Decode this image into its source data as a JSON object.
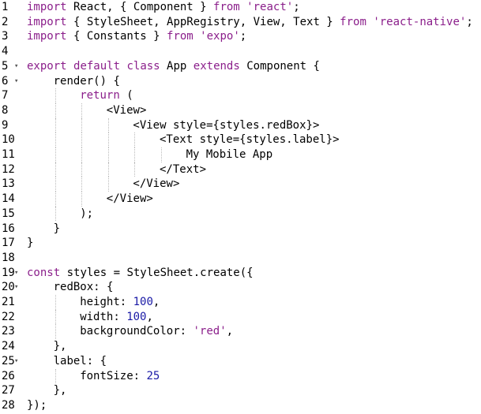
{
  "editor": {
    "lines": [
      {
        "n": "1",
        "fold": "",
        "indent": 0,
        "tokens": [
          {
            "t": "kw",
            "v": "import"
          },
          {
            "t": "plain",
            "v": " React, { Component } "
          },
          {
            "t": "kw",
            "v": "from"
          },
          {
            "t": "plain",
            "v": " "
          },
          {
            "t": "str",
            "v": "'react'"
          },
          {
            "t": "plain",
            "v": ";"
          }
        ]
      },
      {
        "n": "2",
        "fold": "",
        "indent": 0,
        "tokens": [
          {
            "t": "kw",
            "v": "import"
          },
          {
            "t": "plain",
            "v": " { StyleSheet, AppRegistry, View, Text } "
          },
          {
            "t": "kw",
            "v": "from"
          },
          {
            "t": "plain",
            "v": " "
          },
          {
            "t": "str",
            "v": "'react-native'"
          },
          {
            "t": "plain",
            "v": ";"
          }
        ]
      },
      {
        "n": "3",
        "fold": "",
        "indent": 0,
        "tokens": [
          {
            "t": "kw",
            "v": "import"
          },
          {
            "t": "plain",
            "v": " { Constants } "
          },
          {
            "t": "kw",
            "v": "from"
          },
          {
            "t": "plain",
            "v": " "
          },
          {
            "t": "str",
            "v": "'expo'"
          },
          {
            "t": "plain",
            "v": ";"
          }
        ]
      },
      {
        "n": "4",
        "fold": "",
        "indent": 0,
        "tokens": []
      },
      {
        "n": "5",
        "fold": "▾",
        "indent": 0,
        "tokens": [
          {
            "t": "kw",
            "v": "export"
          },
          {
            "t": "plain",
            "v": " "
          },
          {
            "t": "kw",
            "v": "default"
          },
          {
            "t": "plain",
            "v": " "
          },
          {
            "t": "kw",
            "v": "class"
          },
          {
            "t": "plain",
            "v": " App "
          },
          {
            "t": "kw",
            "v": "extends"
          },
          {
            "t": "plain",
            "v": " Component {"
          }
        ]
      },
      {
        "n": "6",
        "fold": "▾",
        "indent": 1,
        "tokens": [
          {
            "t": "plain",
            "v": "render() {"
          }
        ]
      },
      {
        "n": "7",
        "fold": "",
        "indent": 2,
        "tokens": [
          {
            "t": "kw",
            "v": "return"
          },
          {
            "t": "plain",
            "v": " ("
          }
        ]
      },
      {
        "n": "8",
        "fold": "",
        "indent": 3,
        "tokens": [
          {
            "t": "plain",
            "v": "<View>"
          }
        ]
      },
      {
        "n": "9",
        "fold": "",
        "indent": 4,
        "tokens": [
          {
            "t": "plain",
            "v": "<View style={styles.redBox}>"
          }
        ]
      },
      {
        "n": "10",
        "fold": "",
        "indent": 5,
        "tokens": [
          {
            "t": "plain",
            "v": "<Text style={styles.label}>"
          }
        ]
      },
      {
        "n": "11",
        "fold": "",
        "indent": 6,
        "tokens": [
          {
            "t": "plain",
            "v": "My Mobile App"
          }
        ]
      },
      {
        "n": "12",
        "fold": "",
        "indent": 5,
        "tokens": [
          {
            "t": "plain",
            "v": "</Text>"
          }
        ]
      },
      {
        "n": "13",
        "fold": "",
        "indent": 4,
        "tokens": [
          {
            "t": "plain",
            "v": "</View>"
          }
        ]
      },
      {
        "n": "14",
        "fold": "",
        "indent": 3,
        "tokens": [
          {
            "t": "plain",
            "v": "</View>"
          }
        ]
      },
      {
        "n": "15",
        "fold": "",
        "indent": 2,
        "tokens": [
          {
            "t": "plain",
            "v": ");"
          }
        ]
      },
      {
        "n": "16",
        "fold": "",
        "indent": 1,
        "tokens": [
          {
            "t": "plain",
            "v": "}"
          }
        ]
      },
      {
        "n": "17",
        "fold": "",
        "indent": 0,
        "tokens": [
          {
            "t": "plain",
            "v": "}"
          }
        ]
      },
      {
        "n": "18",
        "fold": "",
        "indent": 0,
        "tokens": []
      },
      {
        "n": "19",
        "fold": "▾",
        "indent": 0,
        "tokens": [
          {
            "t": "kw",
            "v": "const"
          },
          {
            "t": "plain",
            "v": " styles = StyleSheet.create({"
          }
        ]
      },
      {
        "n": "20",
        "fold": "▾",
        "indent": 1,
        "tokens": [
          {
            "t": "plain",
            "v": "redBox: {"
          }
        ]
      },
      {
        "n": "21",
        "fold": "",
        "indent": 2,
        "tokens": [
          {
            "t": "plain",
            "v": "height: "
          },
          {
            "t": "num",
            "v": "100"
          },
          {
            "t": "plain",
            "v": ","
          }
        ]
      },
      {
        "n": "22",
        "fold": "",
        "indent": 2,
        "tokens": [
          {
            "t": "plain",
            "v": "width: "
          },
          {
            "t": "num",
            "v": "100"
          },
          {
            "t": "plain",
            "v": ","
          }
        ]
      },
      {
        "n": "23",
        "fold": "",
        "indent": 2,
        "tokens": [
          {
            "t": "plain",
            "v": "backgroundColor: "
          },
          {
            "t": "str",
            "v": "'red'"
          },
          {
            "t": "plain",
            "v": ","
          }
        ]
      },
      {
        "n": "24",
        "fold": "",
        "indent": 1,
        "tokens": [
          {
            "t": "plain",
            "v": "},"
          }
        ]
      },
      {
        "n": "25",
        "fold": "▾",
        "indent": 1,
        "tokens": [
          {
            "t": "plain",
            "v": "label: {"
          }
        ]
      },
      {
        "n": "26",
        "fold": "",
        "indent": 2,
        "tokens": [
          {
            "t": "plain",
            "v": "fontSize: "
          },
          {
            "t": "num",
            "v": "25"
          }
        ]
      },
      {
        "n": "27",
        "fold": "",
        "indent": 1,
        "tokens": [
          {
            "t": "plain",
            "v": "},"
          }
        ]
      },
      {
        "n": "28",
        "fold": "",
        "indent": 0,
        "tokens": [
          {
            "t": "plain",
            "v": "});"
          }
        ]
      }
    ]
  },
  "colors": {
    "keyword": "#8b1f8b",
    "string": "#8b1f8b",
    "number": "#1a1aa6",
    "plain": "#000000",
    "background": "#ffffff"
  }
}
